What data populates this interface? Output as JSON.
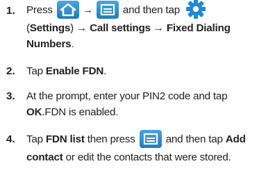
{
  "steps": [
    {
      "number": "1.",
      "line1_pre": "Press",
      "line1_arrow": "→",
      "line1_mid": "and then tap",
      "line2_a": "(",
      "line2_settings": "Settings",
      "line2_b": ") → ",
      "line2_call": "Call settings",
      "line2_c": " → ",
      "line2_fixed": "Fixed Dialing",
      "line3_numbers": "Numbers",
      "line3_end": "."
    },
    {
      "number": "2.",
      "text_pre": "Tap ",
      "text_bold": "Enable FDN",
      "text_end": "."
    },
    {
      "number": "3.",
      "line1": "At the prompt, enter your PIN2 code and tap",
      "line2_ok": "OK",
      "line2_rest": ".FDN is enabled."
    },
    {
      "number": "4.",
      "line1_pre": "Tap ",
      "line1_bold": "FDN list",
      "line1_mid": " then press",
      "line1_post": "and then tap ",
      "line1_add": "Add",
      "line2_contact": "contact",
      "line2_rest": " or edit the contacts that were stored."
    }
  ],
  "icons": {
    "home": "home-icon",
    "menu": "menu-icon",
    "settings": "gear-icon"
  },
  "colors": {
    "text": "#231f20",
    "icon_blue": "#2e8fd0",
    "gear_blue": "#1f8ad4"
  }
}
